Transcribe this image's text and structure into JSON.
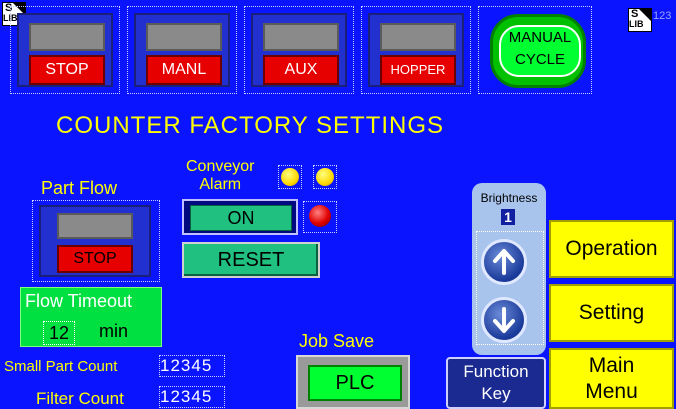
{
  "top_tiles": [
    {
      "label": "STOP"
    },
    {
      "label": "MANL"
    },
    {
      "label": "AUX"
    },
    {
      "label": "HOPPER"
    }
  ],
  "manual_cycle": {
    "line1": "MANUAL",
    "line2": "CYCLE"
  },
  "lib_badge": {
    "s": "S",
    "lib": "LIB"
  },
  "corner_number": "123",
  "title": "COUNTER FACTORY SETTINGS",
  "part_flow": {
    "label": "Part Flow",
    "status": "STOP"
  },
  "conveyor": {
    "line1": "Conveyor",
    "line2": "Alarm",
    "on_label": "ON",
    "reset_label": "RESET"
  },
  "flow_timeout": {
    "label": "Flow Timeout",
    "value": "12",
    "unit": "min"
  },
  "small_part_count": {
    "label": "Small Part Count",
    "value": "12345"
  },
  "filter_count": {
    "label": "Filter Count",
    "value": "12345"
  },
  "job_save": {
    "label": "Job Save",
    "button": "PLC"
  },
  "function_key": {
    "line1": "Function",
    "line2": "Key"
  },
  "brightness": {
    "label": "Brightness",
    "value": "1"
  },
  "side_buttons": {
    "operation": "Operation",
    "setting": "Setting",
    "main_menu_1": "Main",
    "main_menu_2": "Menu"
  },
  "colors": {
    "background": "#0a14ff",
    "title": "#ffff00",
    "green": "#00e040",
    "red": "#e60000",
    "yellow": "#ffff00"
  }
}
